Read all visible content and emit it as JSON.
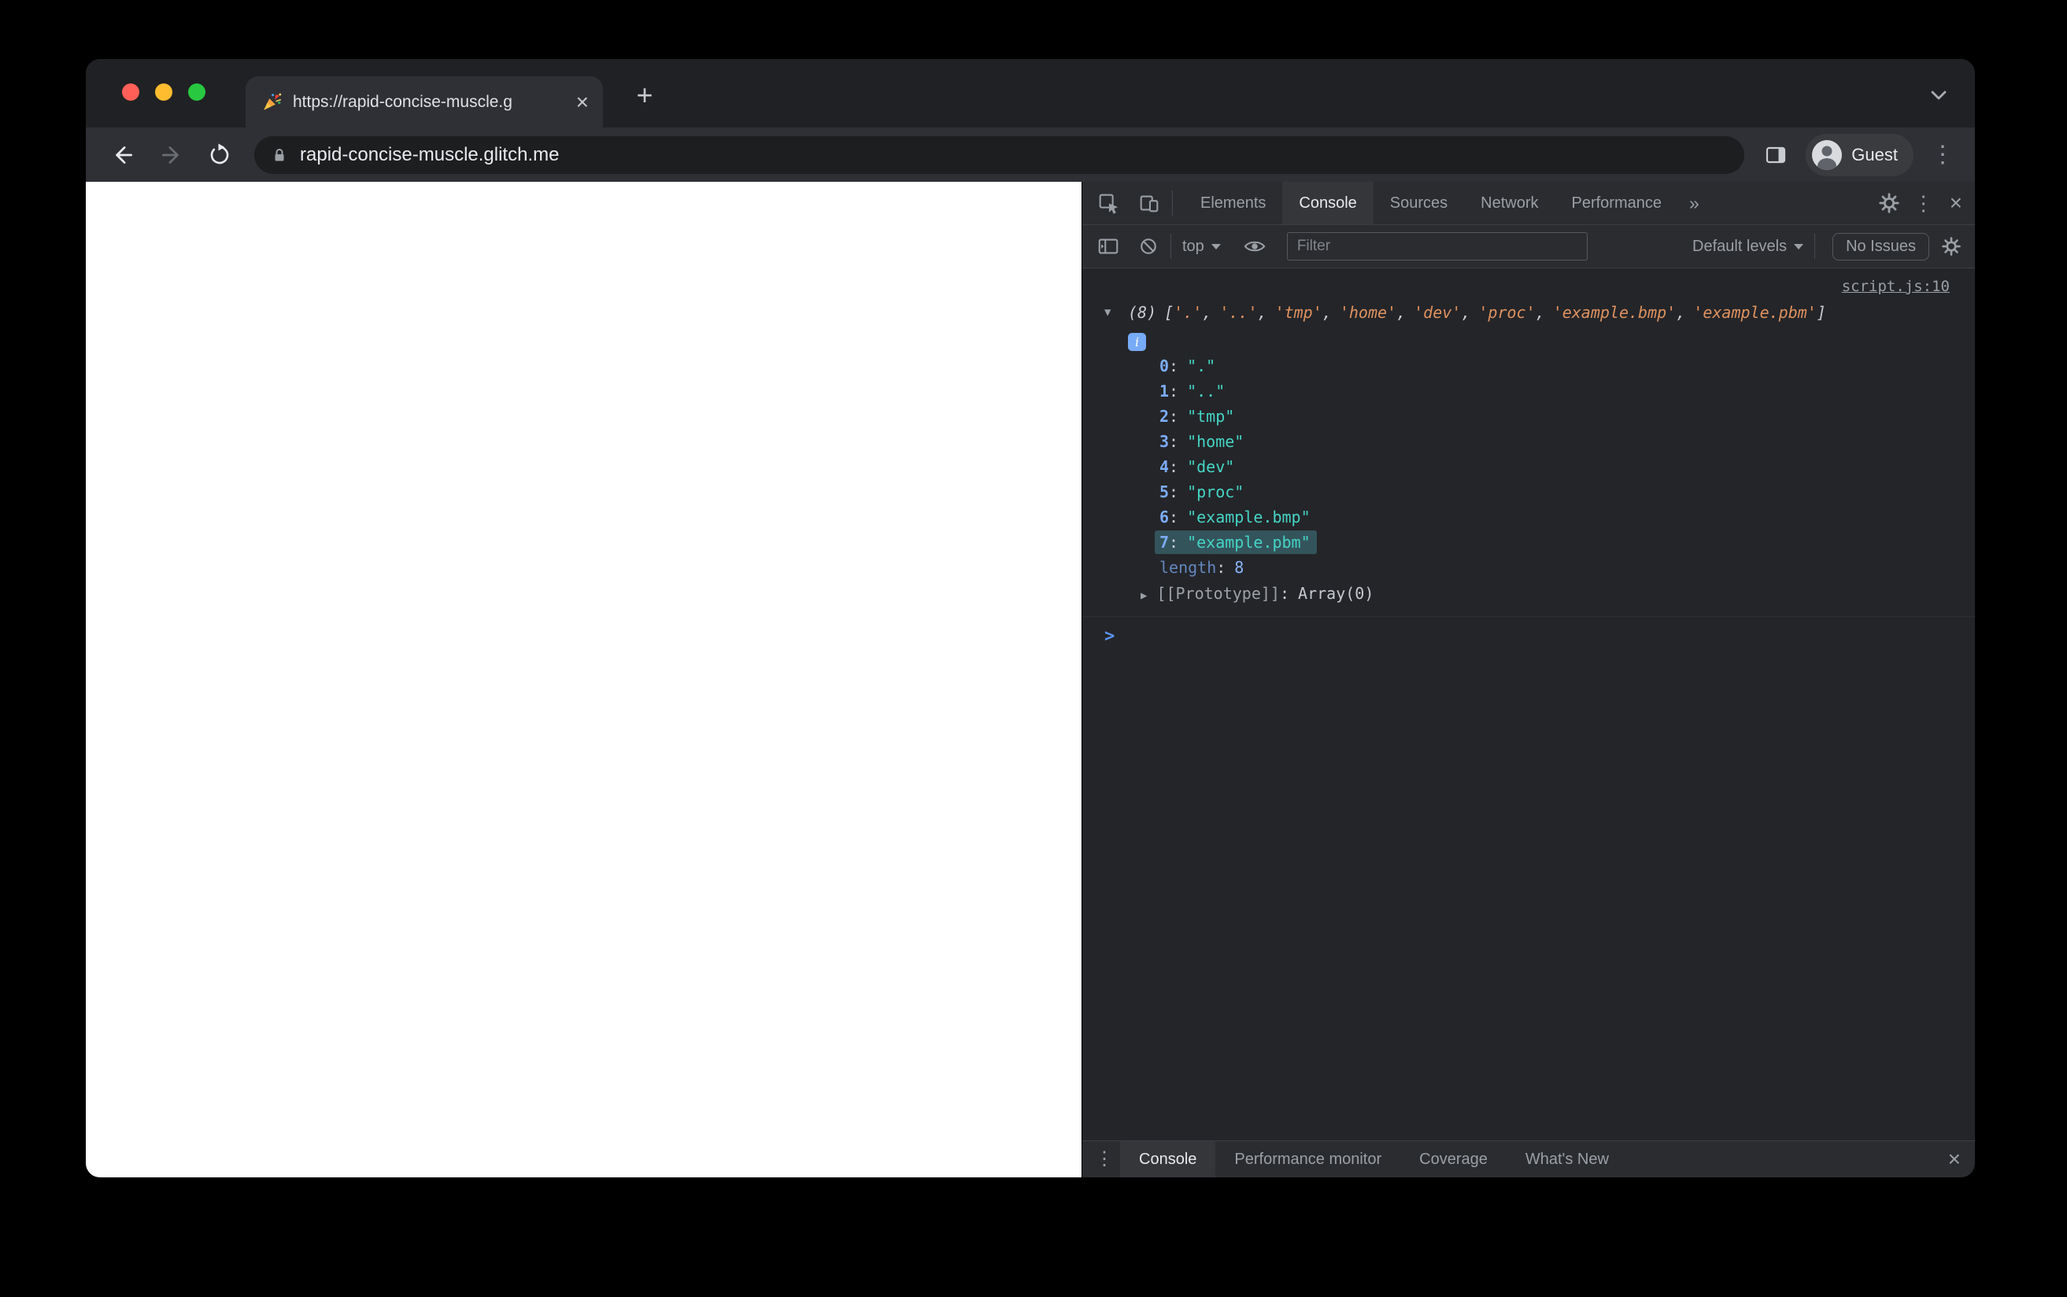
{
  "browser": {
    "tab": {
      "title": "https://rapid-concise-muscle.g"
    },
    "toolbar": {
      "url": "rapid-concise-muscle.glitch.me",
      "profile": "Guest"
    }
  },
  "icons": {
    "close": "×",
    "plus": "+",
    "kebab": "⋮",
    "expander_open": "▼",
    "expander_closed": "▶",
    "info": "i",
    "more_tabs": "»"
  },
  "devtools": {
    "tabs": [
      {
        "label": "Elements"
      },
      {
        "label": "Console"
      },
      {
        "label": "Sources"
      },
      {
        "label": "Network"
      },
      {
        "label": "Performance"
      }
    ],
    "active_tab": "Console",
    "toolbar": {
      "context": "top",
      "filter_placeholder": "Filter",
      "levels": "Default levels",
      "issues": "No Issues"
    },
    "console": {
      "source_link": "script.js:10",
      "preview": {
        "count": "(8)",
        "open": "[",
        "close": "]",
        "sep": ",",
        "items": [
          "'.'",
          "'..'",
          "'tmp'",
          "'home'",
          "'dev'",
          "'proc'",
          "'example.bmp'",
          "'example.pbm'"
        ]
      },
      "entries": [
        {
          "key": "0",
          "value": "\".\""
        },
        {
          "key": "1",
          "value": "\"..\""
        },
        {
          "key": "2",
          "value": "\"tmp\""
        },
        {
          "key": "3",
          "value": "\"home\""
        },
        {
          "key": "4",
          "value": "\"dev\""
        },
        {
          "key": "5",
          "value": "\"proc\""
        },
        {
          "key": "6",
          "value": "\"example.bmp\""
        },
        {
          "key": "7",
          "value": "\"example.pbm\""
        }
      ],
      "highlighted_index": 7,
      "colon": ":",
      "length_key": "length",
      "length_value": "8",
      "prototype_key": "[[Prototype]]",
      "prototype_value": "Array(0)",
      "prompt": ">"
    },
    "drawer": {
      "tabs": [
        {
          "label": "Console"
        },
        {
          "label": "Performance monitor"
        },
        {
          "label": "Coverage"
        },
        {
          "label": "What's New"
        }
      ],
      "active_tab": "Console"
    }
  },
  "colors": {
    "accent_key_blue": "#7CACF8",
    "string_teal": "#45D4C5",
    "preview_string_orange": "#DF925F",
    "number_blue": "#8AB4F8",
    "highlight_teal": "#34545C",
    "traffic_red": "#FF5F57",
    "traffic_yellow": "#FEBC2E",
    "traffic_green": "#28C840"
  }
}
